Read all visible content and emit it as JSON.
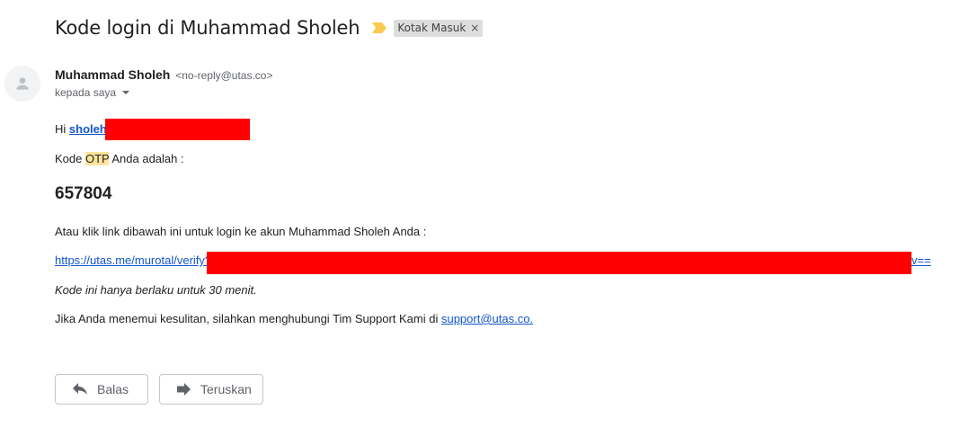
{
  "header": {
    "subject": "Kode login di Muhammad Sholeh",
    "label": "Kotak Masuk",
    "label_remove": "×"
  },
  "sender": {
    "name": "Muhammad Sholeh",
    "email": "<no-reply@utas.co>",
    "to": "kepada saya"
  },
  "message": {
    "greeting_prefix": "Hi",
    "greeting_link": "sholeh",
    "otp_prefix": "Kode ",
    "otp_highlight": "OTP",
    "otp_suffix": " Anda adalah :",
    "code": "657804",
    "link_intro": "Atau klik link dibawah ini untuk login ke akun Muhammad Sholeh Anda :",
    "link_visible_start": "https://utas.me/murotal/verify?",
    "link_visible_end": "v==",
    "validity": "Kode ini hanya berlaku untuk 30 menit.",
    "support_prefix": "Jika Anda menemui kesulitan, silahkan menghubungi Tim Support Kami di ",
    "support_email": "support@utas.co."
  },
  "actions": {
    "reply_label": "Balas",
    "forward_label": "Teruskan"
  },
  "icons": {
    "importance": "importance-marker-icon",
    "avatar": "person-icon",
    "reply": "reply-icon",
    "forward": "forward-icon"
  },
  "colors": {
    "link": "#1155cc",
    "highlight": "#ffe49b",
    "importance": "#f7cb4d",
    "redaction": "#ff0000",
    "label_chip": "#dddddd"
  }
}
